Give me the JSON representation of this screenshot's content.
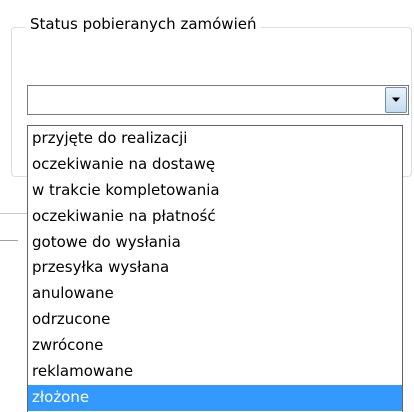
{
  "groupbox": {
    "legend": "Status pobieranych zamówień"
  },
  "combo": {
    "value": "",
    "button_icon": "chevron-down-icon"
  },
  "dropdown": {
    "items": [
      {
        "label": "przyjęte do realizacji",
        "selected": false
      },
      {
        "label": "oczekiwanie na dostawę",
        "selected": false
      },
      {
        "label": "w trakcie kompletowania",
        "selected": false
      },
      {
        "label": "oczekiwanie na płatność",
        "selected": false
      },
      {
        "label": "gotowe do wysłania",
        "selected": false
      },
      {
        "label": "przesyłka wysłana",
        "selected": false
      },
      {
        "label": "anulowane",
        "selected": false
      },
      {
        "label": "odrzucone",
        "selected": false
      },
      {
        "label": "zwrócone",
        "selected": false
      },
      {
        "label": "reklamowane",
        "selected": false
      },
      {
        "label": "złożone",
        "selected": true
      }
    ],
    "highlight_color": "#3399ff"
  }
}
